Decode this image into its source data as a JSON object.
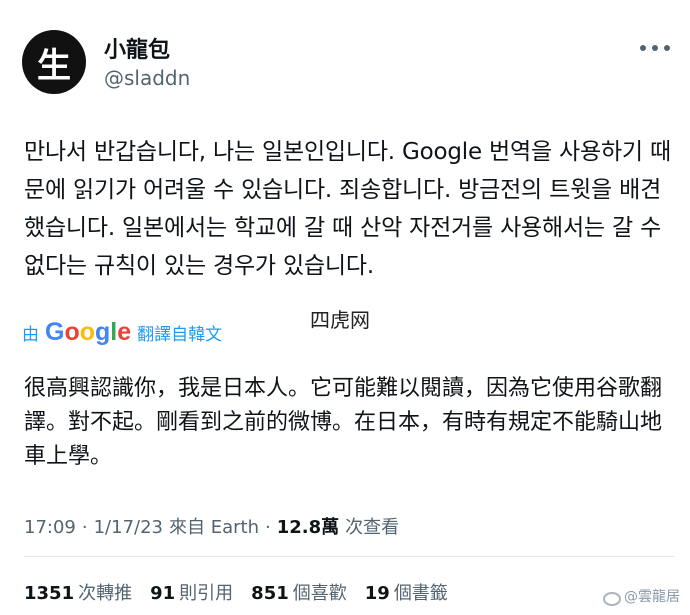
{
  "user": {
    "avatar_char": "生",
    "display_name": "小龍包",
    "handle": "@sladdn"
  },
  "tweet": {
    "text": "만나서 반갑습니다, 나는 일본인입니다. Google 번역을 사용하기 때문에 읽기가 어려울 수 있습니다. 죄송합니다. 방금전의 트윗을 배견했습니다. 일본에서는 학교에 갈 때 산악 자전거를 사용해서는 갈 수 없다는 규칙이 있는 경우가 있습니다."
  },
  "watermark_center": "四虎网",
  "translation": {
    "prefix": "由",
    "provider": "Google",
    "suffix": "翻譯自韓文",
    "text": "很高興認識你，我是日本人。它可能難以閱讀，因為它使用谷歌翻譯。對不起。剛看到之前的微博。在日本，有時有規定不能騎山地車上學。"
  },
  "meta": {
    "time": "17:09",
    "date": "1/17/23",
    "source": "來自 Earth",
    "views_count": "12.8萬",
    "views_label": "次查看"
  },
  "stats": {
    "retweets_count": "1351",
    "retweets_label": "次轉推",
    "quotes_count": "91",
    "quotes_label": "則引用",
    "likes_count": "851",
    "likes_label": "個喜歡",
    "bookmarks_count": "19",
    "bookmarks_label": "個書籤"
  },
  "weibo_watermark": "@雲龍居",
  "colors": {
    "text_primary": "#0f1419",
    "text_secondary": "#536471",
    "link_blue": "#1d9bf0"
  }
}
